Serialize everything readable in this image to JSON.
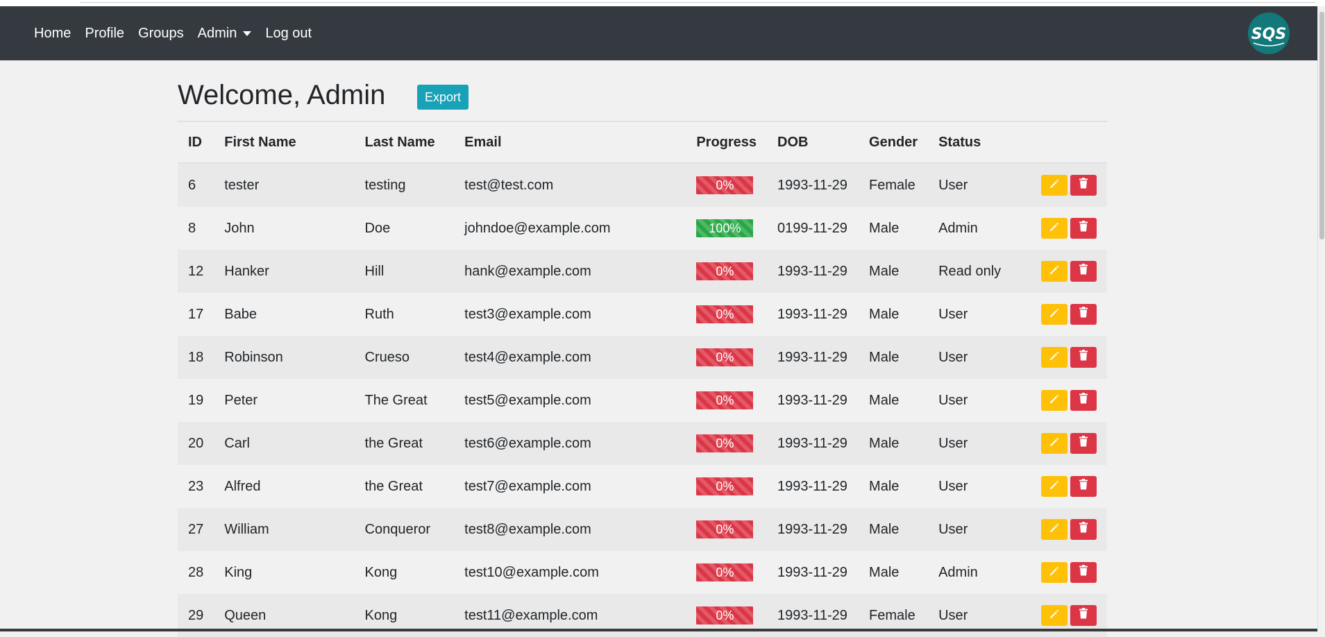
{
  "nav": {
    "items": [
      {
        "label": "Home"
      },
      {
        "label": "Profile"
      },
      {
        "label": "Groups"
      },
      {
        "label": "Admin"
      },
      {
        "label": "Log out"
      }
    ],
    "logo_text": "SQS"
  },
  "page": {
    "title": "Welcome, Admin",
    "export_label": "Export"
  },
  "table": {
    "headers": [
      "ID",
      "First Name",
      "Last Name",
      "Email",
      "Progress",
      "DOB",
      "Gender",
      "Status",
      ""
    ],
    "rows": [
      {
        "id": "6",
        "first": "tester",
        "last": "testing",
        "email": "test@test.com",
        "progress": "0%",
        "progress_status": "danger",
        "dob": "1993-11-29",
        "gender": "Female",
        "status": "User"
      },
      {
        "id": "8",
        "first": "John",
        "last": "Doe",
        "email": "johndoe@example.com",
        "progress": "100%",
        "progress_status": "success",
        "dob": "0199-11-29",
        "gender": "Male",
        "status": "Admin"
      },
      {
        "id": "12",
        "first": "Hanker",
        "last": "Hill",
        "email": "hank@example.com",
        "progress": "0%",
        "progress_status": "danger",
        "dob": "1993-11-29",
        "gender": "Male",
        "status": "Read only"
      },
      {
        "id": "17",
        "first": "Babe",
        "last": "Ruth",
        "email": "test3@example.com",
        "progress": "0%",
        "progress_status": "danger",
        "dob": "1993-11-29",
        "gender": "Male",
        "status": "User"
      },
      {
        "id": "18",
        "first": "Robinson",
        "last": "Crueso",
        "email": "test4@example.com",
        "progress": "0%",
        "progress_status": "danger",
        "dob": "1993-11-29",
        "gender": "Male",
        "status": "User"
      },
      {
        "id": "19",
        "first": "Peter",
        "last": "The Great",
        "email": "test5@example.com",
        "progress": "0%",
        "progress_status": "danger",
        "dob": "1993-11-29",
        "gender": "Male",
        "status": "User"
      },
      {
        "id": "20",
        "first": "Carl",
        "last": "the Great",
        "email": "test6@example.com",
        "progress": "0%",
        "progress_status": "danger",
        "dob": "1993-11-29",
        "gender": "Male",
        "status": "User"
      },
      {
        "id": "23",
        "first": "Alfred",
        "last": "the Great",
        "email": "test7@example.com",
        "progress": "0%",
        "progress_status": "danger",
        "dob": "1993-11-29",
        "gender": "Male",
        "status": "User"
      },
      {
        "id": "27",
        "first": "William",
        "last": "Conqueror",
        "email": "test8@example.com",
        "progress": "0%",
        "progress_status": "danger",
        "dob": "1993-11-29",
        "gender": "Male",
        "status": "User"
      },
      {
        "id": "28",
        "first": "King",
        "last": "Kong",
        "email": "test10@example.com",
        "progress": "0%",
        "progress_status": "danger",
        "dob": "1993-11-29",
        "gender": "Male",
        "status": "Admin"
      },
      {
        "id": "29",
        "first": "Queen",
        "last": "Kong",
        "email": "test11@example.com",
        "progress": "0%",
        "progress_status": "danger",
        "dob": "1993-11-29",
        "gender": "Female",
        "status": "User"
      }
    ]
  },
  "icons": {
    "edit": "pencil-icon",
    "delete": "trash-icon",
    "admin_menu": "caret-down-icon"
  },
  "colors": {
    "navbar": "#343a40",
    "export": "#17a2b8",
    "edit": "#ffc107",
    "delete": "#dc3545",
    "progress_danger": "#dc3545",
    "progress_success": "#28a745"
  }
}
